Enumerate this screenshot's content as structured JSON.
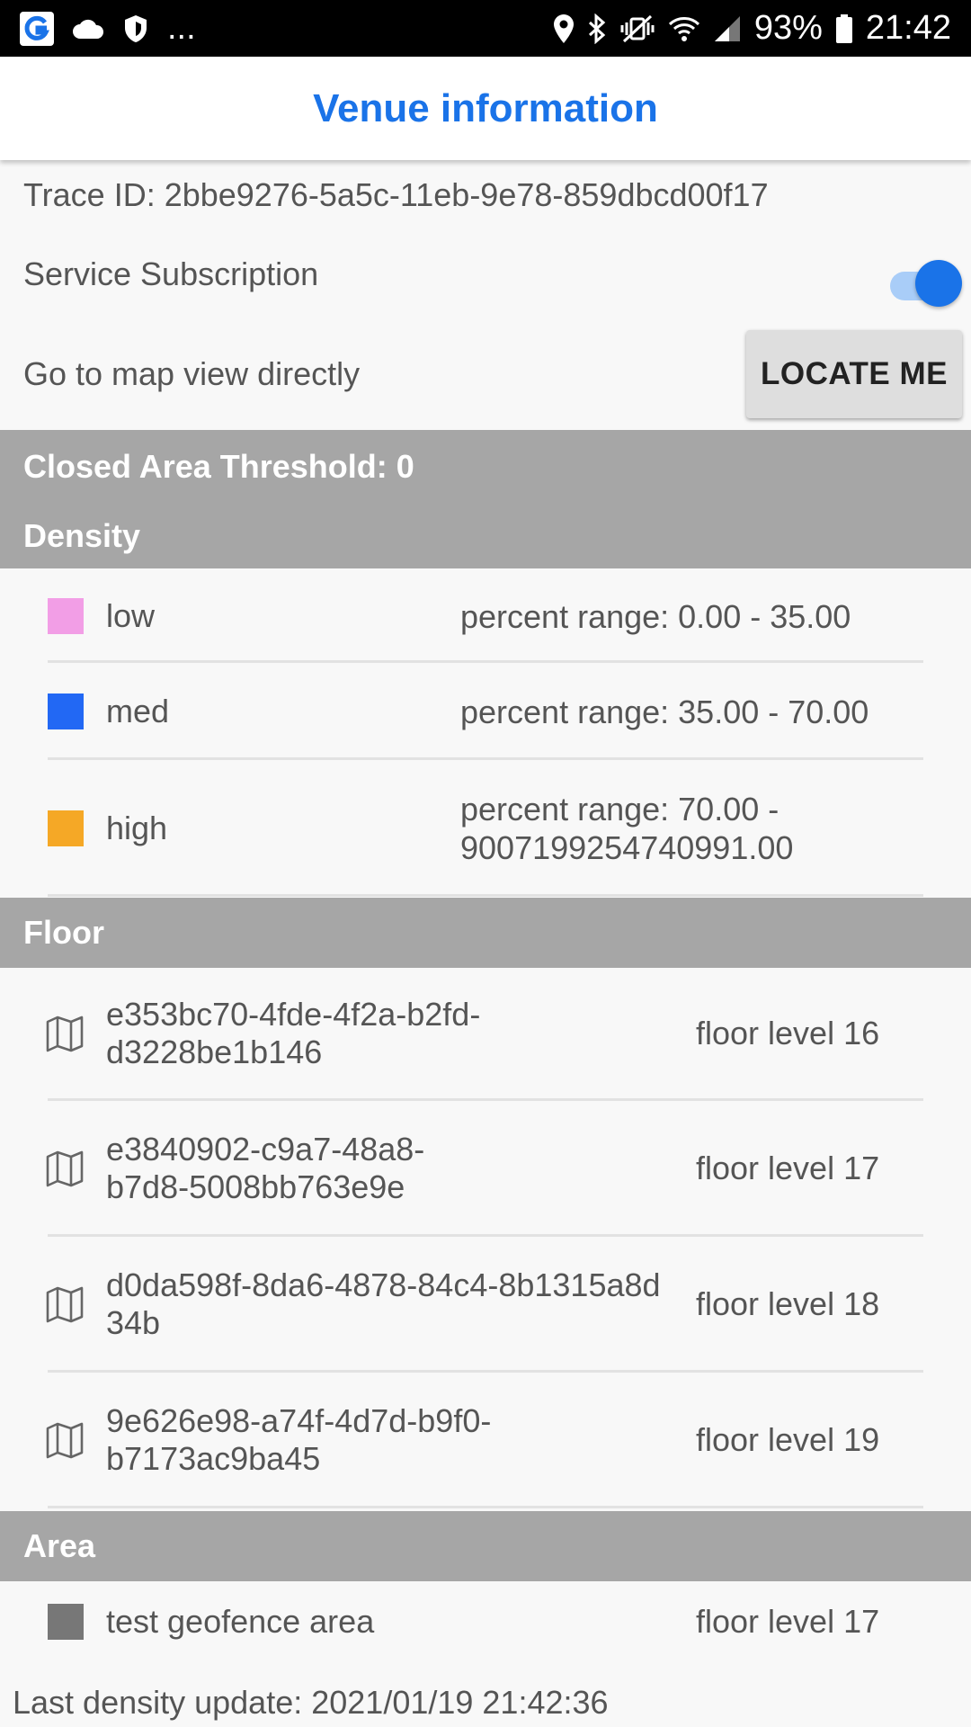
{
  "status_bar": {
    "left_icons": [
      "app-g-icon",
      "cloud-icon",
      "shield-icon"
    ],
    "more": "...",
    "battery": "93%",
    "time": "21:42"
  },
  "app_bar": {
    "title": "Venue information"
  },
  "trace": {
    "label": "Trace ID: 2bbe9276-5a5c-11eb-9e78-859dbcd00f17"
  },
  "subscription": {
    "label": "Service Subscription",
    "enabled": true
  },
  "map_view": {
    "label": "Go to map view directly",
    "button": "LOCATE ME"
  },
  "threshold": {
    "label": "Closed Area Threshold: 0"
  },
  "density": {
    "header": "Density",
    "items": [
      {
        "name": "low",
        "color": "#f29ee6",
        "range": "percent range: 0.00 - 35.00"
      },
      {
        "name": "med",
        "color": "#2268f4",
        "range": "percent range: 35.00 - 70.00"
      },
      {
        "name": "high",
        "color": "#f5a826",
        "range_line1": "percent range: 70.00 -",
        "range_line2": "9007199254740991.00"
      }
    ]
  },
  "floor": {
    "header": "Floor",
    "items": [
      {
        "id_line1": "e353bc70-4fde-4f2a-b2fd-",
        "id_line2": "d3228be1b146",
        "level": "floor level 16"
      },
      {
        "id_line1": "e3840902-c9a7-48a8-",
        "id_line2": "b7d8-5008bb763e9e",
        "level": "floor level 17"
      },
      {
        "id_line1": "d0da598f-8da6-4878-84c4-8b1315a8d",
        "id_line2": "34b",
        "level": "floor level 18"
      },
      {
        "id_line1": "9e626e98-a74f-4d7d-b9f0-",
        "id_line2": "b7173ac9ba45",
        "level": "floor level 19"
      }
    ]
  },
  "area": {
    "header": "Area",
    "items": [
      {
        "name": "test geofence area",
        "color": "#777777",
        "level": "floor level 17"
      }
    ]
  },
  "footer": {
    "last_update": "Last density update: 2021/01/19 21:42:36"
  },
  "colors": {
    "accent": "#1a73e8",
    "section_header_bg": "#a6a6a6"
  }
}
